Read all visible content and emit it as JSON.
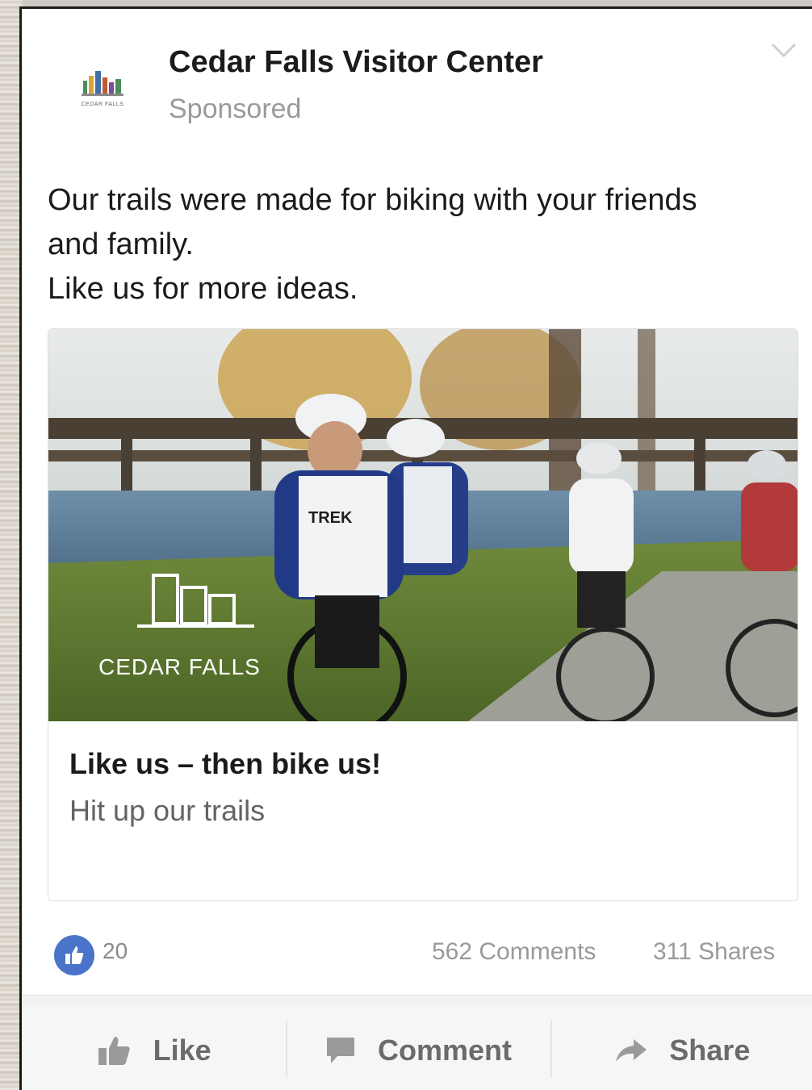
{
  "post": {
    "page_name": "Cedar Falls Visitor Center",
    "sponsored_label": "Sponsored",
    "avatar_caption": "CEDAR FALLS",
    "text_lines": [
      "Our trails were made for biking with your friends",
      "and family.",
      "Like us for more ideas."
    ]
  },
  "link_preview": {
    "image_watermark": "CEDAR FALLS",
    "jersey_text": "TREK",
    "headline": "Like us – then bike us!",
    "subtitle": "Hit up our trails"
  },
  "stats": {
    "like_count": "20",
    "comments": "562 Comments",
    "shares": "311 Shares"
  },
  "actions": {
    "like": "Like",
    "comment": "Comment",
    "share": "Share"
  },
  "colors": {
    "like_badge": "#4a74c9",
    "muted_text": "#9a9a9a",
    "action_text": "#6b6b6b"
  },
  "icons": {
    "menu": "chevron-down-icon",
    "like_badge": "thumbs-up-icon",
    "like_action": "thumbs-up-icon",
    "comment_action": "speech-bubble-icon",
    "share_action": "share-arrow-icon"
  }
}
